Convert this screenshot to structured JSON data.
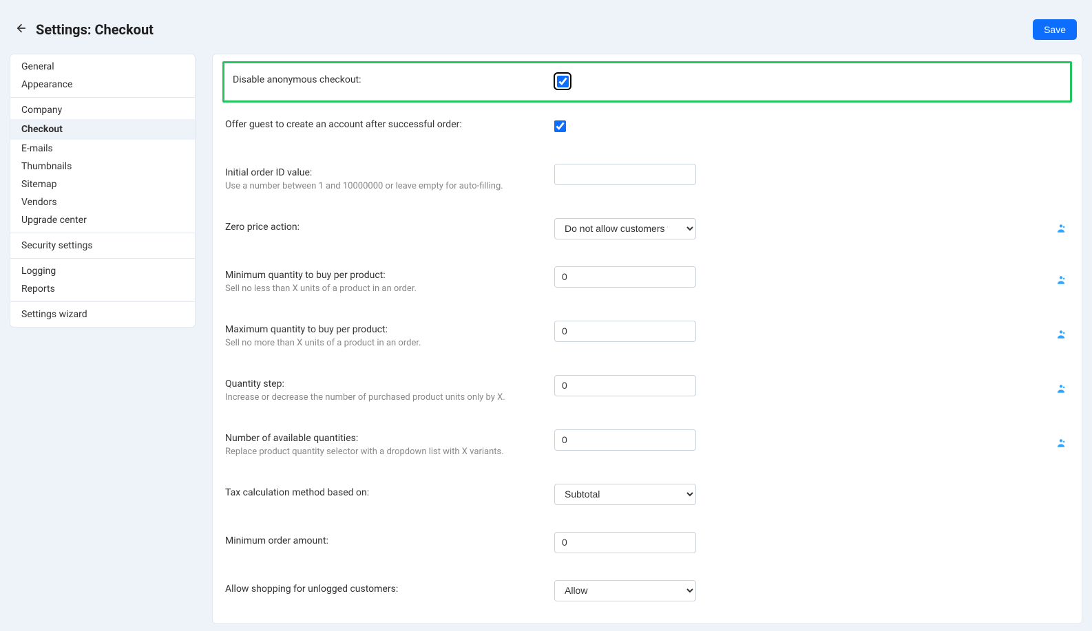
{
  "header": {
    "title": "Settings: Checkout",
    "save_label": "Save"
  },
  "sidebar": {
    "groups": [
      {
        "items": [
          {
            "label": "General",
            "key": "general"
          },
          {
            "label": "Appearance",
            "key": "appearance"
          }
        ]
      },
      {
        "items": [
          {
            "label": "Company",
            "key": "company"
          },
          {
            "label": "Checkout",
            "key": "checkout",
            "active": true
          },
          {
            "label": "E-mails",
            "key": "emails"
          },
          {
            "label": "Thumbnails",
            "key": "thumbnails"
          },
          {
            "label": "Sitemap",
            "key": "sitemap"
          },
          {
            "label": "Vendors",
            "key": "vendors"
          },
          {
            "label": "Upgrade center",
            "key": "upgrade-center"
          }
        ]
      },
      {
        "items": [
          {
            "label": "Security settings",
            "key": "security-settings"
          }
        ]
      },
      {
        "items": [
          {
            "label": "Logging",
            "key": "logging"
          },
          {
            "label": "Reports",
            "key": "reports"
          }
        ]
      },
      {
        "items": [
          {
            "label": "Settings wizard",
            "key": "settings-wizard"
          }
        ]
      }
    ]
  },
  "form": {
    "disable_anon": {
      "label": "Disable anonymous checkout:",
      "checked": true
    },
    "offer_guest": {
      "label": "Offer guest to create an account after successful order:",
      "checked": true
    },
    "initial_order_id": {
      "label": "Initial order ID value:",
      "hint": "Use a number between 1 and 10000000 or leave empty for auto-filling.",
      "value": ""
    },
    "zero_price": {
      "label": "Zero price action:",
      "selected": "Do not allow customers to ad"
    },
    "min_qty": {
      "label": "Minimum quantity to buy per product:",
      "hint": "Sell no less than X units of a product in an order.",
      "value": "0"
    },
    "max_qty": {
      "label": "Maximum quantity to buy per product:",
      "hint": "Sell no more than X units of a product in an order.",
      "value": "0"
    },
    "qty_step": {
      "label": "Quantity step:",
      "hint": "Increase or decrease the number of purchased product units only by X.",
      "value": "0"
    },
    "avail_qty": {
      "label": "Number of available quantities:",
      "hint": "Replace product quantity selector with a dropdown list with X variants.",
      "value": "0"
    },
    "tax_method": {
      "label": "Tax calculation method based on:",
      "selected": "Subtotal"
    },
    "min_order": {
      "label": "Minimum order amount:",
      "value": "0"
    },
    "unlogged": {
      "label": "Allow shopping for unlogged customers:",
      "selected": "Allow"
    }
  }
}
